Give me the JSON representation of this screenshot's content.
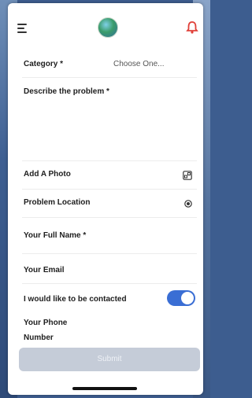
{
  "header": {
    "menu_icon": "hamburger-menu-icon",
    "logo_icon": "globe-logo-icon",
    "notification_icon": "bell-icon",
    "notification_color": "#e0413a"
  },
  "form": {
    "category_label": "Category *",
    "category_placeholder": "Choose One...",
    "description_label": "Describe the problem *",
    "photo_label": "Add A Photo",
    "photo_icon": "add-photo-icon",
    "location_label": "Problem Location",
    "location_icon": "location-target-icon",
    "fullname_label": "Your Full Name *",
    "email_label": "Your Email",
    "contact_label": "I would like to be contacted",
    "contact_toggle_on": true,
    "phone_label_line1": "Your Phone",
    "phone_label_line2": "Number",
    "submit_label": "Submit"
  },
  "colors": {
    "accent": "#3a6ed4",
    "submit_disabled": "#c5ccd8"
  }
}
